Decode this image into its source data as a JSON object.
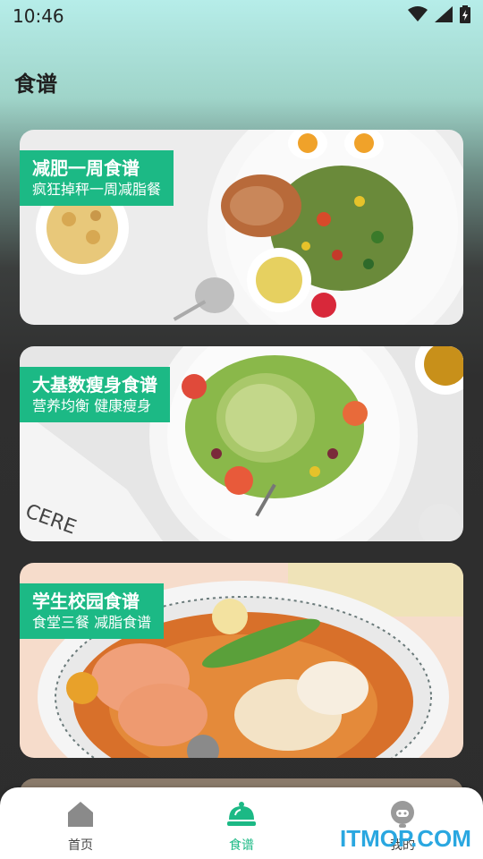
{
  "status_bar": {
    "time": "10:46"
  },
  "page": {
    "title": "食谱"
  },
  "cards": [
    {
      "title": "减肥一周食谱",
      "subtitle": "疯狂掉秤一周减脂餐"
    },
    {
      "title": "大基数瘦身食谱",
      "subtitle": "营养均衡 健康瘦身"
    },
    {
      "title": "学生校园食谱",
      "subtitle": "食堂三餐 减脂食谱"
    }
  ],
  "nav": {
    "items": [
      {
        "label": "首页",
        "icon": "home-icon"
      },
      {
        "label": "食谱",
        "icon": "dish-cloche-icon"
      },
      {
        "label": "我的",
        "icon": "user-icon"
      }
    ],
    "active_index": 1
  },
  "watermark": {
    "text": "ITMOP.COM"
  },
  "colors": {
    "accent": "#1cb985",
    "nav_inactive": "#888888",
    "watermark": "#2aa7e0"
  }
}
